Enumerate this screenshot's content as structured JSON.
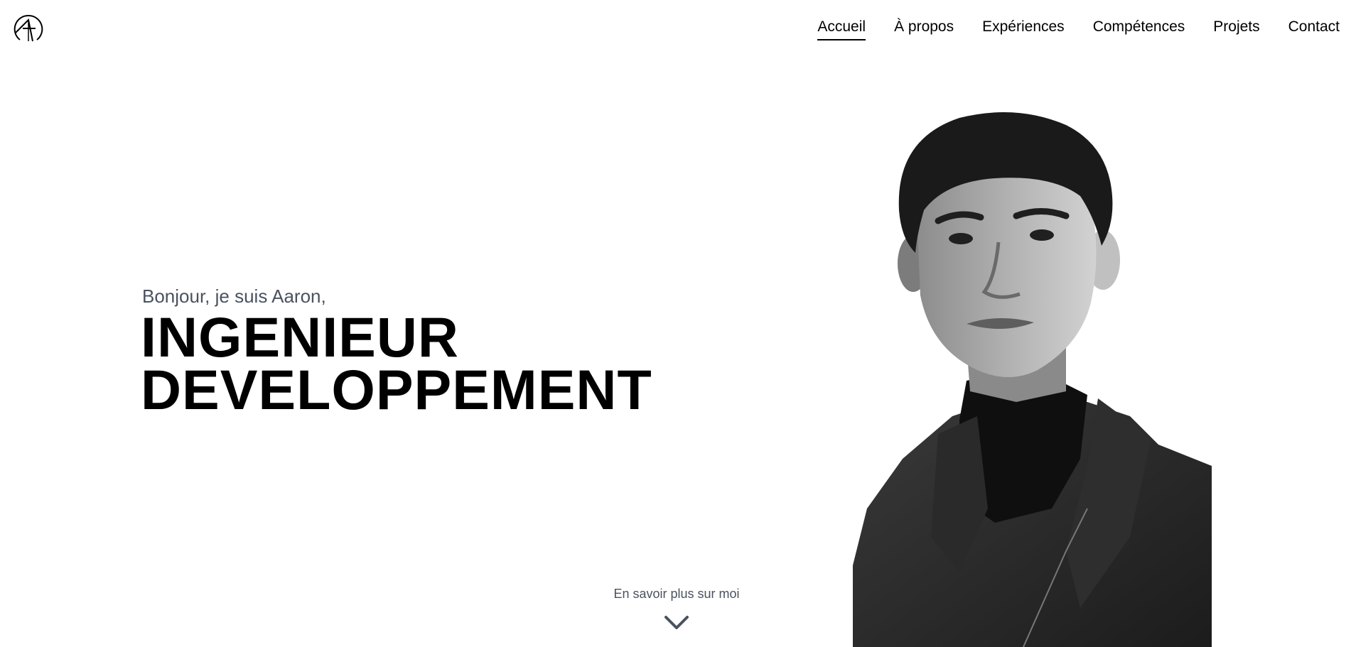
{
  "header": {
    "logo_icon": "monogram-logo-icon",
    "nav": [
      {
        "label": "Accueil",
        "active": true
      },
      {
        "label": "À propos",
        "active": false
      },
      {
        "label": "Expériences",
        "active": false
      },
      {
        "label": "Compétences",
        "active": false
      },
      {
        "label": "Projets",
        "active": false
      },
      {
        "label": "Contact",
        "active": false
      }
    ]
  },
  "hero": {
    "greeting": "Bonjour, je suis Aaron,",
    "title_line1": "INGENIEUR",
    "title_line2": "DEVELOPPEMENT",
    "portrait_icon": "portrait-photo"
  },
  "scroll_cue": {
    "label": "En savoir plus sur moi",
    "icon": "chevron-down-icon"
  },
  "colors": {
    "text": "#000000",
    "muted": "#4a5260",
    "background": "#ffffff"
  }
}
